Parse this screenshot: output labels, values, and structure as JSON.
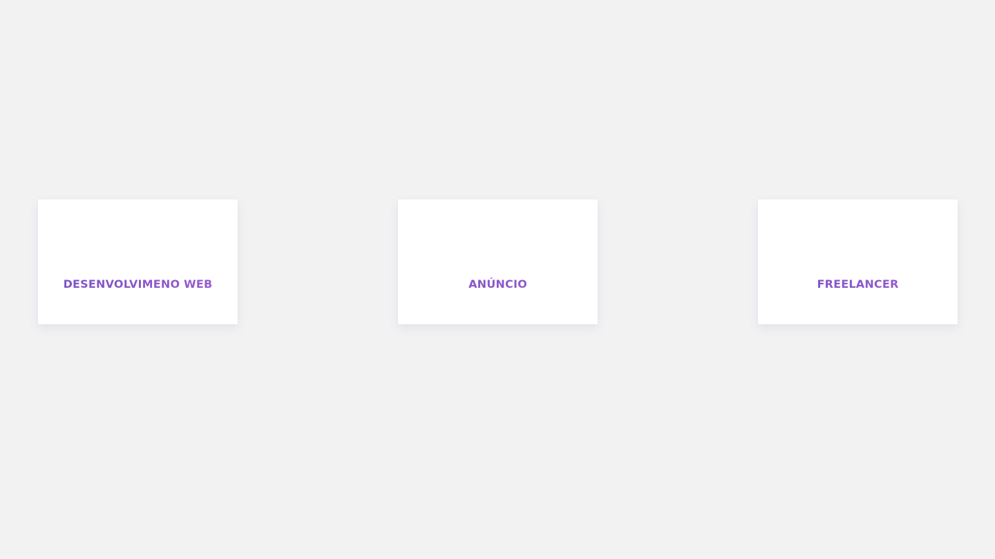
{
  "cards": [
    {
      "title": "DESENVOLVIMENO WEB"
    },
    {
      "title": "ANÚNCIO"
    },
    {
      "title": "FREELANCER"
    }
  ],
  "colors": {
    "background": "#f2f2f3",
    "card": "#ffffff",
    "accent_start": "#7b52c6",
    "accent_end": "#9a5cd0"
  }
}
